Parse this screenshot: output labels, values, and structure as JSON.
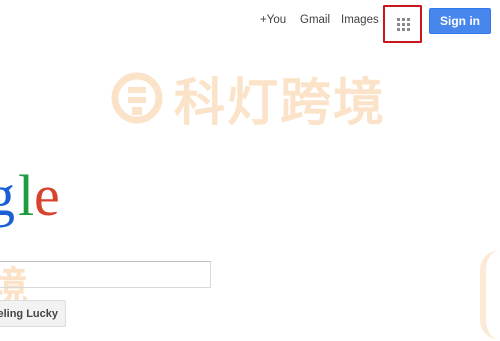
{
  "nav": {
    "you_label": "+You",
    "gmail_label": "Gmail",
    "images_label": "Images",
    "apps_icon": "apps-grid-icon",
    "signin_label": "Sign in"
  },
  "watermark": {
    "text": "科灯跨境",
    "left_fragment": "境"
  },
  "logo": {
    "visible_text": "gle"
  },
  "search": {
    "value": "",
    "placeholder": ""
  },
  "buttons": {
    "lucky_label": "eeling Lucky"
  },
  "colors": {
    "signin_bg": "#4787ed",
    "highlight_box": "#c8161d",
    "watermark": "#fbe2c7",
    "g_blue": "#1a5fd3",
    "l_green": "#1c9b3f",
    "e_red": "#d8412e"
  }
}
